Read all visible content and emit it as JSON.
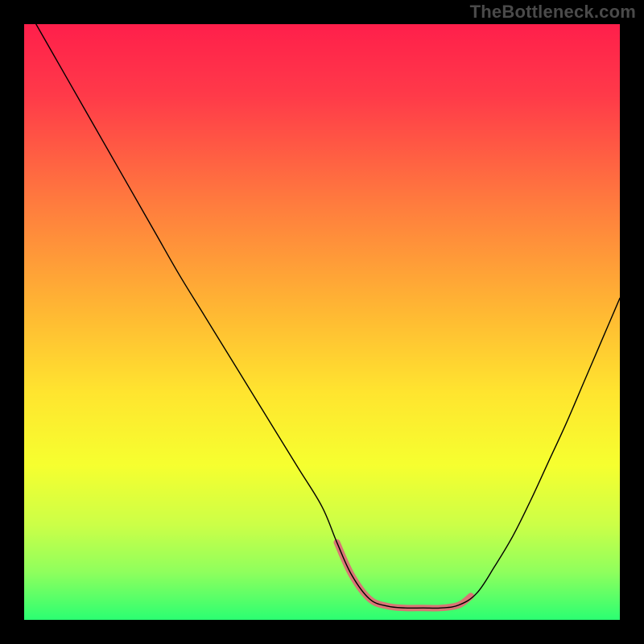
{
  "watermark": "TheBottleneck.com",
  "chart_data": {
    "type": "line",
    "title": "",
    "xlabel": "",
    "ylabel": "",
    "xlim": [
      0,
      100
    ],
    "ylim": [
      0,
      100
    ],
    "grid": false,
    "legend": false,
    "background_gradient_stops": [
      {
        "offset": 0.0,
        "color": "#ff1f4b"
      },
      {
        "offset": 0.12,
        "color": "#ff3a49"
      },
      {
        "offset": 0.3,
        "color": "#ff7b3e"
      },
      {
        "offset": 0.48,
        "color": "#ffb733"
      },
      {
        "offset": 0.62,
        "color": "#ffe52f"
      },
      {
        "offset": 0.74,
        "color": "#f6ff2f"
      },
      {
        "offset": 0.84,
        "color": "#ccff47"
      },
      {
        "offset": 0.92,
        "color": "#8fff5d"
      },
      {
        "offset": 1.0,
        "color": "#2bff72"
      }
    ],
    "series": [
      {
        "name": "main-curve",
        "color": "#000000",
        "width": 1.4,
        "x": [
          2,
          6,
          10,
          14,
          18,
          22,
          26,
          30,
          34,
          38,
          42,
          46,
          50,
          52.5,
          55,
          58,
          61,
          64,
          67,
          70,
          73,
          76,
          79,
          82,
          85,
          88,
          91,
          94,
          97,
          100
        ],
        "y": [
          100,
          93,
          86,
          79,
          72,
          65,
          58,
          51.5,
          45,
          38.5,
          32,
          25.5,
          19,
          13,
          7.5,
          3.5,
          2.3,
          2.0,
          2.0,
          2.0,
          2.5,
          4.5,
          9,
          14,
          20,
          26.5,
          33,
          40,
          47,
          54
        ]
      },
      {
        "name": "highlight-segment",
        "color": "#d97575",
        "width": 8,
        "linecap": "round",
        "x": [
          52.5,
          55,
          58,
          61,
          64,
          67,
          70,
          73,
          75
        ],
        "y": [
          13,
          7.5,
          3.5,
          2.3,
          2.0,
          2.0,
          2.0,
          2.5,
          4.0
        ]
      }
    ]
  }
}
